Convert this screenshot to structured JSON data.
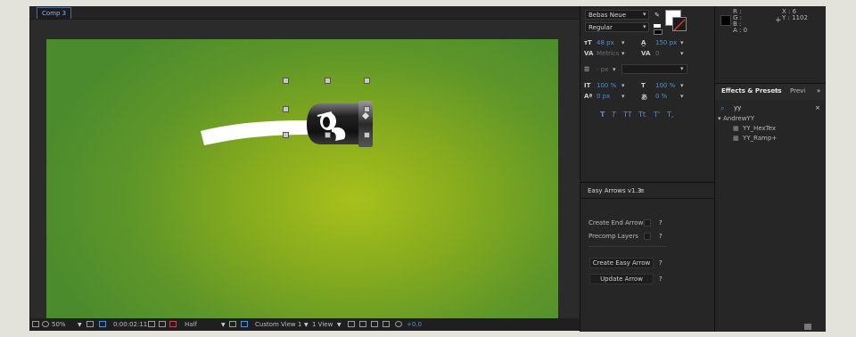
{
  "comp": {
    "tab_label": "Comp 3",
    "statusbar": {
      "zoom": "50%",
      "timecode": "0:00:02:11",
      "resolution": "Half",
      "view": "Custom View 1",
      "layout": "1 View",
      "exposure": "+0.0"
    }
  },
  "character": {
    "font_family": "Bebas Neue",
    "font_style": "Regular",
    "font_size": "48 px",
    "leading": "150 px",
    "kerning": "Metrics",
    "tracking": "0",
    "stroke": "- px",
    "vscale": "100 %",
    "hscale": "100 %",
    "baseline": "0 px",
    "tsume": "0 %",
    "styles": [
      "T",
      "T",
      "TT",
      "Tt",
      "T'",
      "T,"
    ],
    "fill_color": "#ffffff",
    "stroke_color": "#000000"
  },
  "easy_arrows": {
    "title": "Easy Arrows v1.3",
    "menu_icon": "≡",
    "create_end_arrow": "Create End Arrow",
    "precomp_layers": "Precomp Layers",
    "create_button": "Create Easy Arrow",
    "update_button": "Update Arrow",
    "help": "?"
  },
  "info": {
    "r": "R :",
    "g": "G :",
    "b": "B :",
    "a": "A : 0",
    "x": "X : 6",
    "y": "Y : 1102"
  },
  "effects": {
    "tab_active": "Effects & Presets",
    "tab_menu": "≡",
    "tab_other": "Previ",
    "more": "»",
    "search_value": "yy",
    "clear": "×",
    "folder": "AndrewYY",
    "items": [
      "YY_HexTex",
      "YY_Ramp+"
    ]
  },
  "colors": {
    "canvas_center": "#a8c01c",
    "canvas_edge": "#4c8b2d",
    "accent_blue": "#4a8fe0"
  }
}
